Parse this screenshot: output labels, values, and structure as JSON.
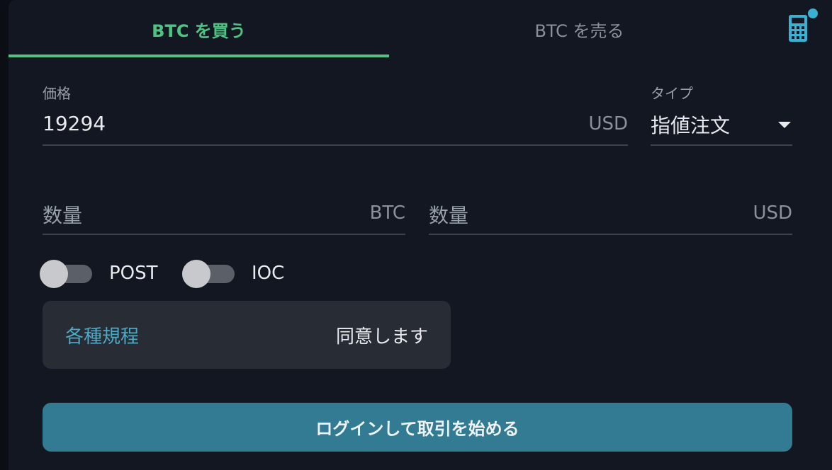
{
  "tabs": {
    "buy_label": "BTC を買う",
    "sell_label": "BTC を売る",
    "active": "buy"
  },
  "toolbar": {
    "calculator_icon": "calculator-icon",
    "notification_dot_color": "#3ab1d2"
  },
  "price": {
    "label": "価格",
    "value": "19294",
    "unit": "USD"
  },
  "order_type": {
    "label": "タイプ",
    "selected": "指値注文"
  },
  "quantity_btc": {
    "placeholder": "数量",
    "unit": "BTC"
  },
  "quantity_usd": {
    "placeholder": "数量",
    "unit": "USD"
  },
  "toggles": {
    "post": {
      "label": "POST",
      "enabled": false
    },
    "ioc": {
      "label": "IOC",
      "enabled": false
    }
  },
  "agreement": {
    "link_label": "各種規程",
    "action_label": "同意します"
  },
  "login_button": {
    "label": "ログインして取引を始める"
  },
  "colors": {
    "accent_green": "#4fc383",
    "accent_blue": "#327b92",
    "link_blue": "#4da9c4",
    "background": "#121721"
  }
}
